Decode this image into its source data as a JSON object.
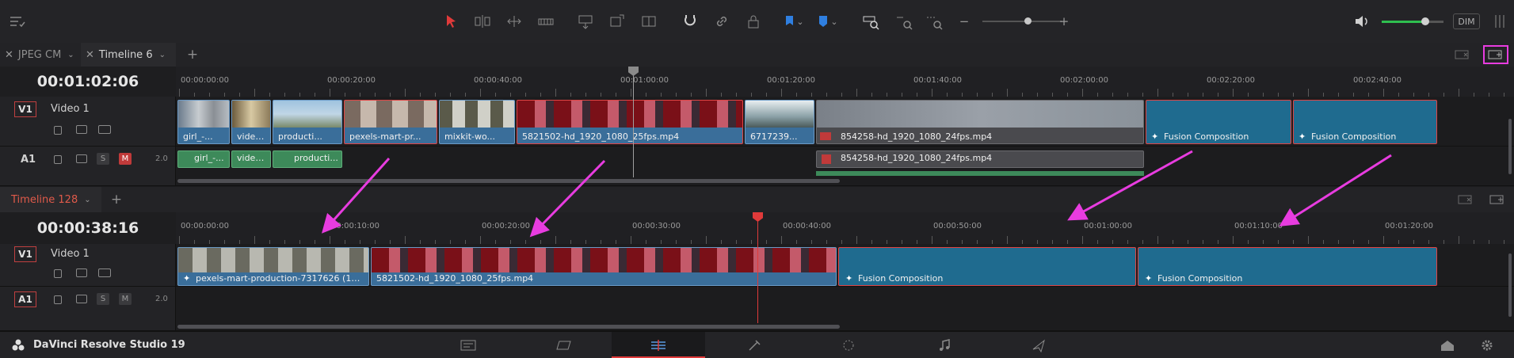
{
  "toolbar": {
    "icons": [
      "layout-icon",
      "pointer-icon",
      "trim-icon",
      "dynamic-trim-icon",
      "blade-icon",
      "insert-icon",
      "overwrite-icon",
      "replace-icon",
      "snapping-icon",
      "link-icon",
      "lock-icon",
      "flag-icon",
      "marker-icon",
      "zoom-full-icon",
      "zoom-detail-icon",
      "zoom-custom-icon",
      "volume-icon",
      "mixer-icon"
    ],
    "zoom_minus": "−",
    "zoom_plus": "+",
    "dim_label": "DIM",
    "accent_color": "#e03a3a"
  },
  "upper_timeline": {
    "tabs": [
      {
        "label": "JPEG CM"
      },
      {
        "label": "Timeline 6"
      }
    ],
    "add_tab": "+",
    "timecode": "00:01:02:06",
    "ruler_labels": [
      "00:00:00:00",
      "00:00:20:00",
      "00:00:40:00",
      "00:01:00:00",
      "00:01:20:00",
      "00:01:40:00",
      "00:02:00:00",
      "00:02:20:00",
      "00:02:40:00"
    ],
    "video_track": {
      "badge": "V1",
      "name": "Video 1"
    },
    "audio_track": {
      "badge": "A1",
      "solo": "S",
      "mute": "M",
      "level": "2.0"
    },
    "video_clips": [
      {
        "label": "girl_-..."
      },
      {
        "label": "video ..."
      },
      {
        "label": "producti..."
      },
      {
        "label": "pexels-mart-pr..."
      },
      {
        "label": "mixkit-wo..."
      },
      {
        "label": "5821502-hd_1920_1080_25fps.mp4"
      },
      {
        "label": "6717239..."
      },
      {
        "label": "854258-hd_1920_1080_24fps.mp4"
      },
      {
        "label": "Fusion Composition"
      },
      {
        "label": "Fusion Composition"
      }
    ],
    "audio_clips": [
      {
        "label": "girl_-..."
      },
      {
        "label": "video ..."
      },
      {
        "label": "producti..."
      },
      {
        "label": "854258-hd_1920_1080_24fps.mp4"
      }
    ]
  },
  "lower_timeline": {
    "tab": {
      "label": "Timeline 128"
    },
    "add_tab": "+",
    "timecode": "00:00:38:16",
    "ruler_labels": [
      "00:00:00:00",
      "00:00:10:00",
      "00:00:20:00",
      "00:00:30:00",
      "00:00:40:00",
      "00:00:50:00",
      "00:01:00:00",
      "00:01:10:00",
      "00:01:20:00"
    ],
    "video_track": {
      "badge": "V1",
      "name": "Video 1"
    },
    "audio_track": {
      "badge": "A1",
      "solo": "S",
      "mute": "M",
      "level": "2.0"
    },
    "video_clips": [
      {
        "label": "pexels-mart-production-7317626 (1080..."
      },
      {
        "label": "5821502-hd_1920_1080_25fps.mp4"
      },
      {
        "label": "Fusion Composition"
      },
      {
        "label": "Fusion Composition"
      }
    ]
  },
  "annotation_arrow_color": "#e83ce0",
  "bottom_bar": {
    "app_name": "DaVinci Resolve Studio 19",
    "pages": [
      "media-page-icon",
      "cut-page-icon",
      "edit-page-icon",
      "fusion-page-icon",
      "color-page-icon",
      "fairlight-page-icon",
      "deliver-page-icon"
    ],
    "active_page": "edit-page-icon"
  }
}
